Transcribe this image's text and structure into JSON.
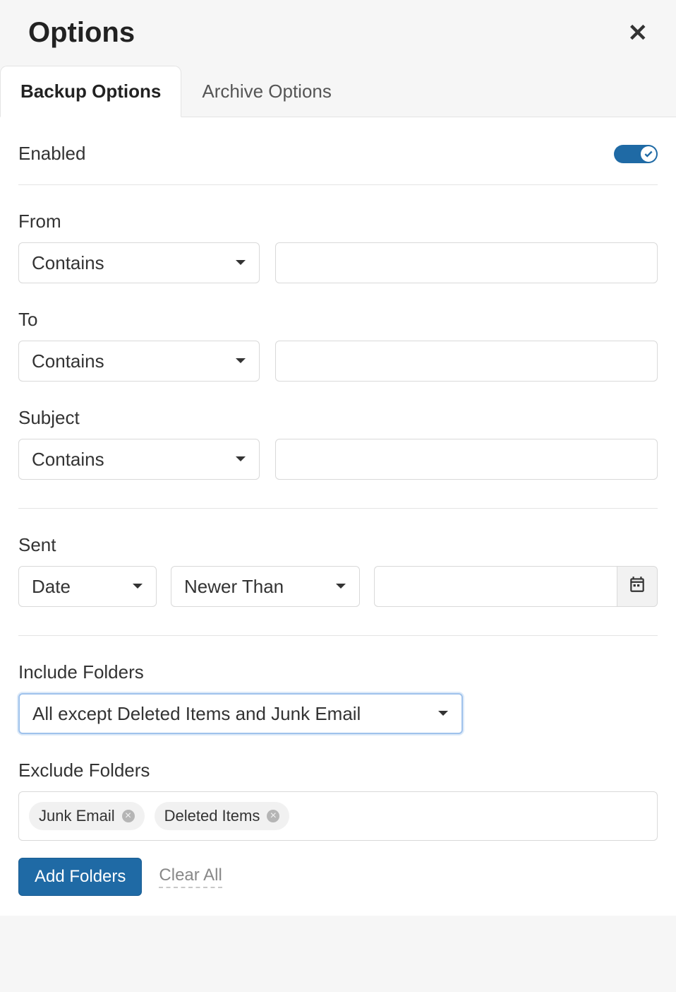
{
  "dialog": {
    "title": "Options"
  },
  "tabs": {
    "backup": "Backup Options",
    "archive": "Archive Options"
  },
  "enabled": {
    "label": "Enabled",
    "state": true
  },
  "filters": {
    "from": {
      "label": "From",
      "condition": "Contains",
      "value": ""
    },
    "to": {
      "label": "To",
      "condition": "Contains",
      "value": ""
    },
    "subject": {
      "label": "Subject",
      "condition": "Contains",
      "value": ""
    }
  },
  "sent": {
    "label": "Sent",
    "type": "Date",
    "condition": "Newer Than",
    "value": ""
  },
  "includeFolders": {
    "label": "Include Folders",
    "selected": "All except Deleted Items and Junk Email"
  },
  "excludeFolders": {
    "label": "Exclude Folders",
    "tags": [
      "Junk Email",
      "Deleted Items"
    ]
  },
  "actions": {
    "addFolders": "Add Folders",
    "clearAll": "Clear All"
  }
}
